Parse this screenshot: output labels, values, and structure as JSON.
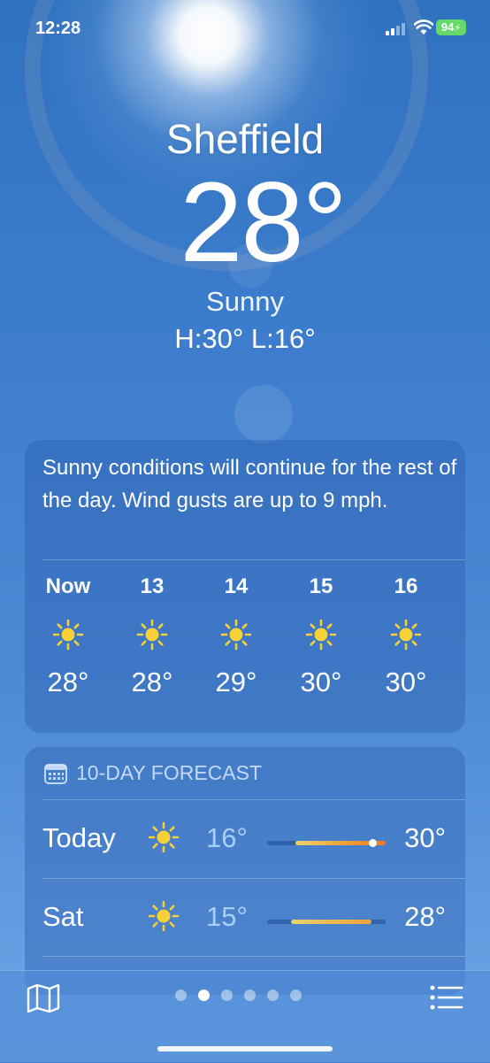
{
  "status_bar": {
    "time": "12:28",
    "battery": "94"
  },
  "location": {
    "city": "Sheffield",
    "temperature": "28°",
    "condition": "Sunny",
    "high_low": "H:30°  L:16°"
  },
  "summary": {
    "text": "Sunny conditions will continue for the rest of the day. Wind gusts are up to 9 mph.",
    "hourly": [
      {
        "label": "Now",
        "icon": "sun-icon",
        "temp": "28°"
      },
      {
        "label": "13",
        "icon": "sun-icon",
        "temp": "28°"
      },
      {
        "label": "14",
        "icon": "sun-icon",
        "temp": "29°"
      },
      {
        "label": "15",
        "icon": "sun-icon",
        "temp": "30°"
      },
      {
        "label": "16",
        "icon": "sun-icon",
        "temp": "30°"
      }
    ]
  },
  "forecast": {
    "title": "10-DAY FORECAST",
    "days": [
      {
        "day": "Today",
        "icon": "sun-icon",
        "low": "16°",
        "high": "30°",
        "range_start": 0.24,
        "range_end": 1.0,
        "current": 0.89
      },
      {
        "day": "Sat",
        "icon": "sun-icon",
        "low": "15°",
        "high": "28°",
        "range_start": 0.2,
        "range_end": 0.88
      }
    ]
  },
  "pages": {
    "count": 6,
    "active_index": 1
  },
  "colors": {
    "sun": "#f7d038",
    "battery": "#65d96a",
    "bar_cool": "#e9d36c",
    "bar_warm": "#f0a13a",
    "bar_hot": "#ee7a2a"
  }
}
